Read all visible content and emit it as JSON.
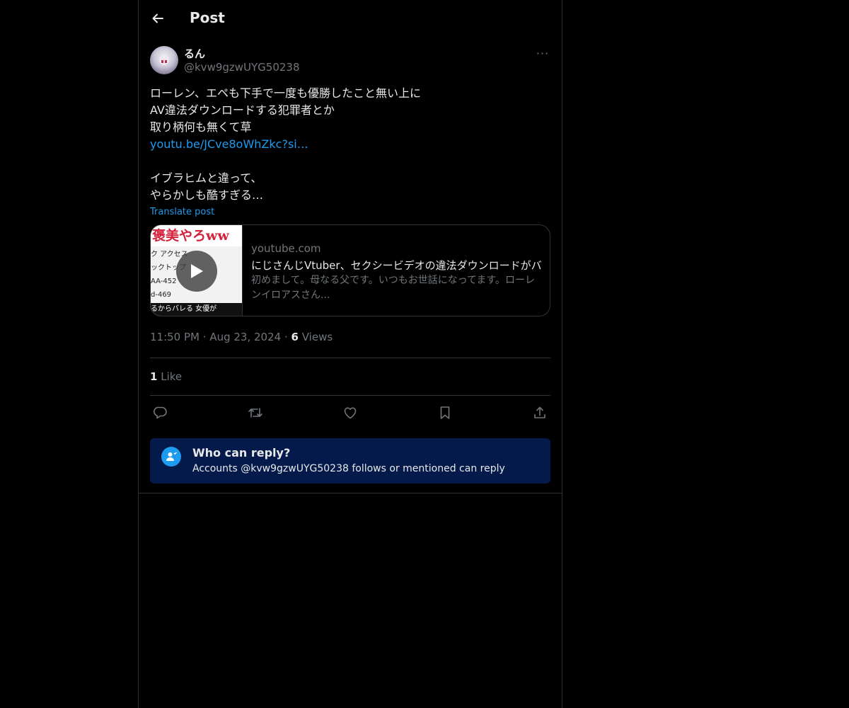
{
  "header": {
    "back_icon": "arrow-left-icon",
    "title": "Post"
  },
  "author": {
    "display_name": "るん",
    "handle": "@kvw9gzwUYG50238",
    "more_label": "···"
  },
  "post": {
    "lines": [
      "ローレン、エペも下手で一度も優勝したこと無い上に",
      "AV違法ダウンロードする犯罪者とか",
      "取り柄何も無くて草"
    ],
    "link": "youtu.be/JCve8oWhZkc?si…",
    "lines2": [
      "イブラヒムと違って、",
      "やらかしも酷すぎる…"
    ],
    "translate_label": "Translate post"
  },
  "card": {
    "thumbnail_banner": "褒美やろww",
    "thumbnail_rows": [
      "ク アクセス",
      "ックトップ",
      "AA-452",
      "d-469"
    ],
    "thumbnail_footer": "るからバレる   女優が",
    "domain": "youtube.com",
    "title": "にじさんじVtuber、セクシービデオの違法ダウンロードがバ",
    "description": "初めまして。母なる父です。いつもお世話になってます。ローレンイロアスさん..."
  },
  "meta": {
    "time": "11:50 PM",
    "date": "Aug 23, 2024",
    "views_count": "6",
    "views_label": "Views",
    "separator": "·"
  },
  "engagement": {
    "likes_count": "1",
    "likes_label": "Like"
  },
  "actions": [
    "reply-icon",
    "repost-icon",
    "like-icon",
    "bookmark-icon",
    "share-icon"
  ],
  "reply_restriction": {
    "title": "Who can reply?",
    "subtitle": "Accounts @kvw9gzwUYG50238 follows or mentioned can reply"
  },
  "colors": {
    "background": "#000000",
    "text": "#e7e9ea",
    "muted": "#71767b",
    "accent": "#1d9bf0",
    "reply_box": "#041a4a",
    "border": "#2f3336"
  }
}
